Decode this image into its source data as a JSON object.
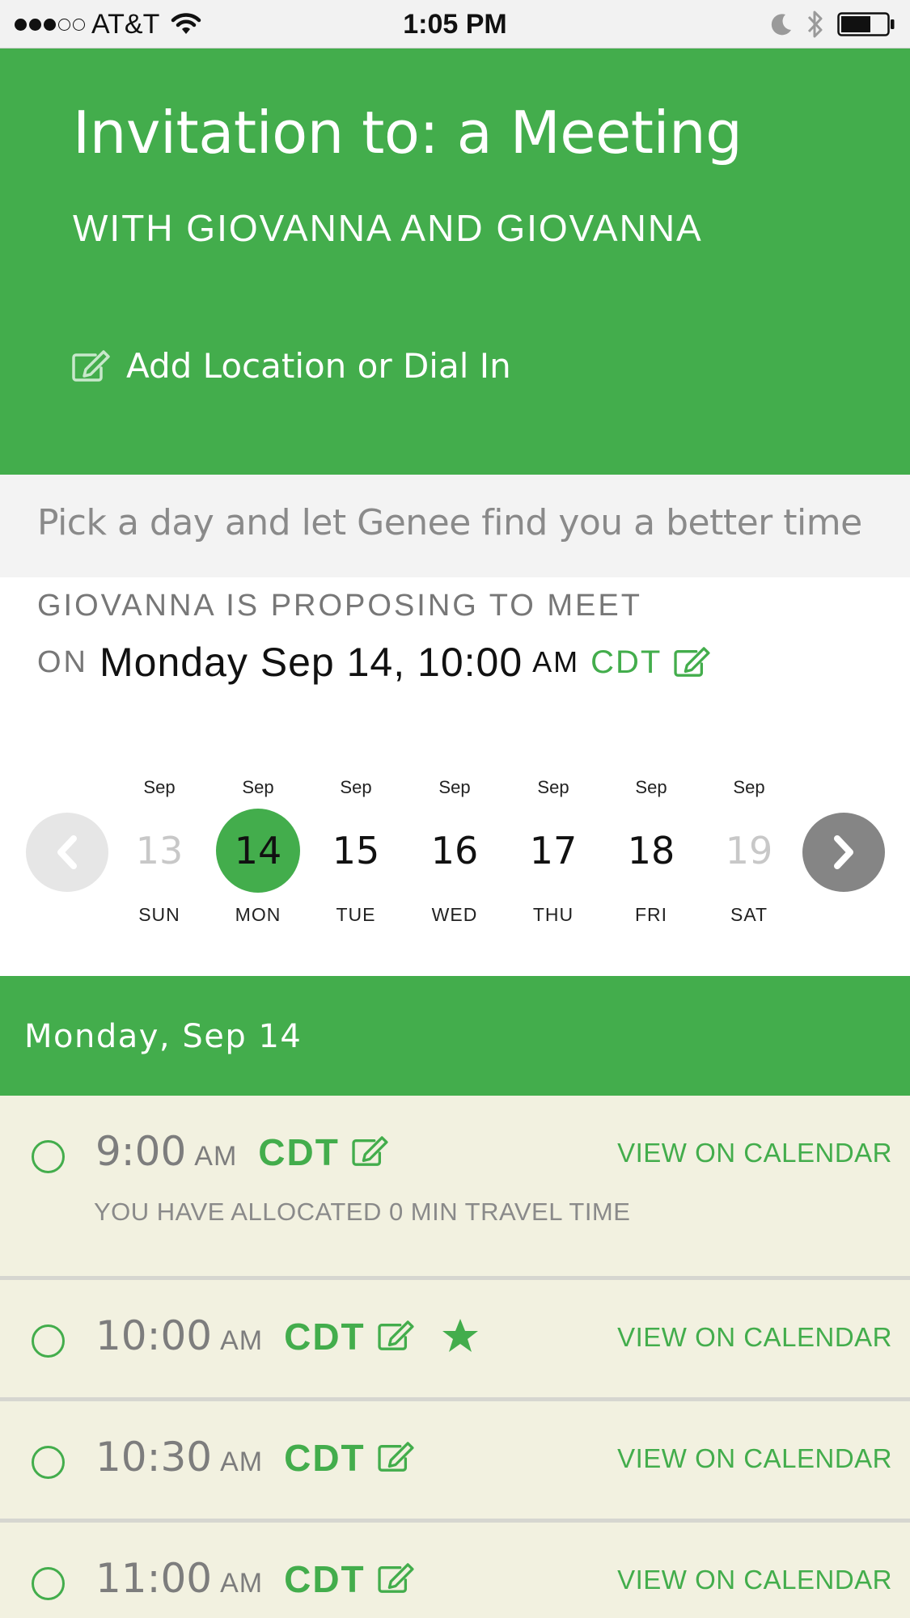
{
  "status_bar": {
    "carrier": "AT&T",
    "time": "1:05 PM",
    "signal_filled": 3,
    "signal_total": 5,
    "icons": [
      "signal-dots-icon",
      "wifi-icon",
      "moon-icon",
      "bluetooth-icon",
      "battery-icon"
    ]
  },
  "header": {
    "title": "Invitation to: a Meeting",
    "subtitle": "WITH GIOVANNA AND GIOVANNA",
    "add_location_label": "Add Location or Dial In",
    "background_color": "#43ad4c"
  },
  "hint": {
    "text": "Pick a day and let Genee find you a better time"
  },
  "proposal": {
    "line1": "GIOVANNA IS PROPOSING TO MEET",
    "on": "ON",
    "date_time": "Monday Sep 14, 10:00",
    "ampm": "AM",
    "timezone": "CDT"
  },
  "date_picker": {
    "days": [
      {
        "month": "Sep",
        "day": "13",
        "weekday": "SUN",
        "state": "disabled"
      },
      {
        "month": "Sep",
        "day": "14",
        "weekday": "MON",
        "state": "selected"
      },
      {
        "month": "Sep",
        "day": "15",
        "weekday": "TUE",
        "state": "normal"
      },
      {
        "month": "Sep",
        "day": "16",
        "weekday": "WED",
        "state": "normal"
      },
      {
        "month": "Sep",
        "day": "17",
        "weekday": "THU",
        "state": "normal"
      },
      {
        "month": "Sep",
        "day": "18",
        "weekday": "FRI",
        "state": "normal"
      },
      {
        "month": "Sep",
        "day": "19",
        "weekday": "SAT",
        "state": "disabled"
      }
    ]
  },
  "day_section": {
    "title": "Monday, Sep 14"
  },
  "slots": [
    {
      "time": "9:00",
      "ampm": "AM",
      "timezone": "CDT",
      "starred": false,
      "link": "VIEW ON CALENDAR",
      "travel_note": "YOU HAVE ALLOCATED 0 MIN TRAVEL TIME"
    },
    {
      "time": "10:00",
      "ampm": "AM",
      "timezone": "CDT",
      "starred": true,
      "link": "VIEW ON CALENDAR"
    },
    {
      "time": "10:30",
      "ampm": "AM",
      "timezone": "CDT",
      "starred": false,
      "link": "VIEW ON CALENDAR"
    },
    {
      "time": "11:00",
      "ampm": "AM",
      "timezone": "CDT",
      "starred": false,
      "link": "VIEW ON CALENDAR"
    }
  ],
  "colors": {
    "accent_green": "#43ad4c",
    "slot_background": "#f2f1e0"
  }
}
